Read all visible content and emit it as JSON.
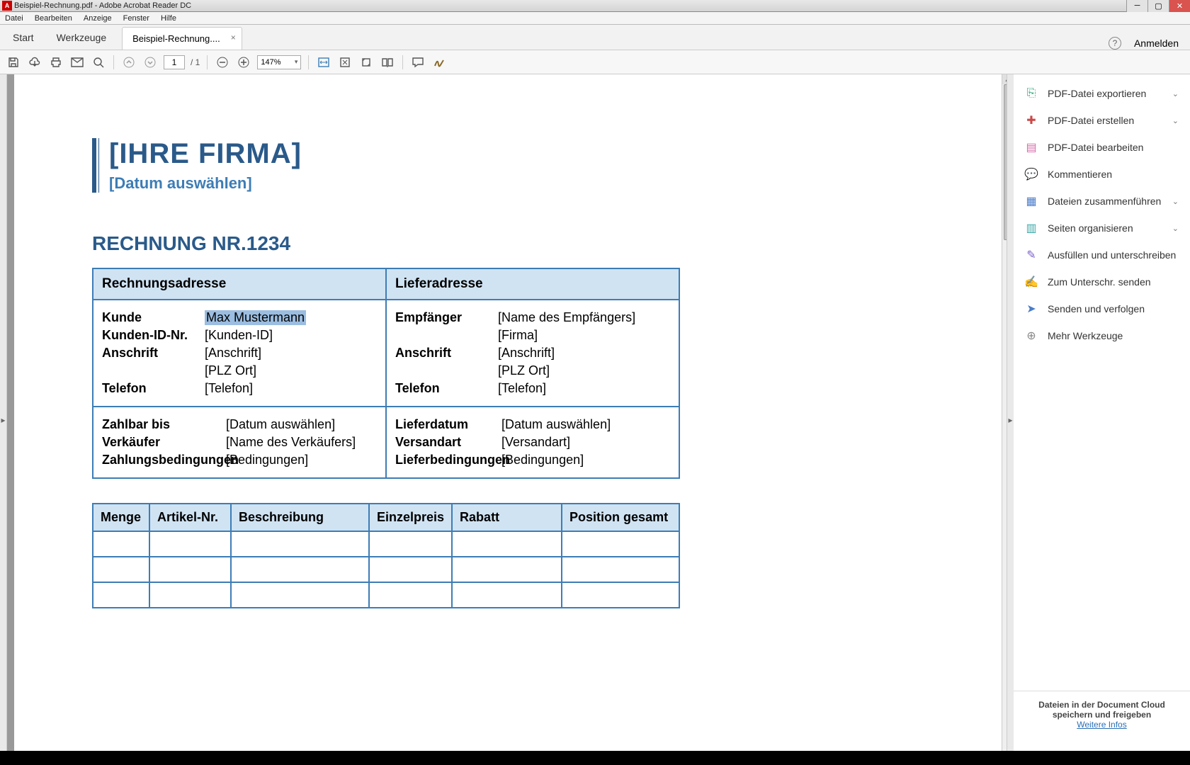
{
  "window": {
    "title": "Beispiel-Rechnung.pdf - Adobe Acrobat Reader DC"
  },
  "menu": {
    "items": [
      "Datei",
      "Bearbeiten",
      "Anzeige",
      "Fenster",
      "Hilfe"
    ]
  },
  "tabs": {
    "start": "Start",
    "tools": "Werkzeuge",
    "doc": "Beispiel-Rechnung....",
    "signin": "Anmelden"
  },
  "toolbar": {
    "page_current": "1",
    "page_total": "/ 1",
    "zoom": "147%"
  },
  "doc": {
    "company": "[IHRE FIRMA]",
    "date_select": "[Datum auswählen]",
    "invoice_title": "RECHNUNG NR.1234",
    "billing_header": "Rechnungsadresse",
    "shipping_header": "Lieferadresse",
    "billing": {
      "customer_label": "Kunde",
      "customer_value": "Max Mustermann",
      "id_label": "Kunden-ID-Nr.",
      "id_value": "[Kunden-ID]",
      "address_label": "Anschrift",
      "address_value1": "[Anschrift]",
      "address_value2": "[PLZ Ort]",
      "phone_label": "Telefon",
      "phone_value": "[Telefon]"
    },
    "shipping": {
      "recipient_label": "Empfänger",
      "recipient_value1": "[Name des Empfängers]",
      "recipient_value2": "[Firma]",
      "address_label": "Anschrift",
      "address_value1": "[Anschrift]",
      "address_value2": "[PLZ Ort]",
      "phone_label": "Telefon",
      "phone_value": "[Telefon]"
    },
    "terms_left": {
      "due_label": "Zahlbar bis",
      "due_value": "[Datum auswählen]",
      "seller_label": "Verkäufer",
      "seller_value": "[Name des Verkäufers]",
      "pay_label": "Zahlungsbedingungen",
      "pay_value": "[Bedingungen]"
    },
    "terms_right": {
      "delivery_label": "Lieferdatum",
      "delivery_value": "[Datum auswählen]",
      "ship_label": "Versandart",
      "ship_value": "[Versandart]",
      "cond_label": "Lieferbedingungen",
      "cond_value": "[Bedingungen]"
    },
    "items_headers": {
      "qty": "Menge",
      "sku": "Artikel-Nr.",
      "desc": "Beschreibung",
      "price": "Einzelpreis",
      "discount": "Rabatt",
      "total": "Position gesamt"
    }
  },
  "side": {
    "items": [
      "PDF-Datei exportieren",
      "PDF-Datei erstellen",
      "PDF-Datei bearbeiten",
      "Kommentieren",
      "Dateien zusammenführen",
      "Seiten organisieren",
      "Ausfüllen und unterschreiben",
      "Zum Unterschr. senden",
      "Senden und verfolgen",
      "Mehr Werkzeuge"
    ],
    "footer_text": "Dateien in der Document Cloud speichern und freigeben",
    "footer_link": "Weitere Infos"
  }
}
